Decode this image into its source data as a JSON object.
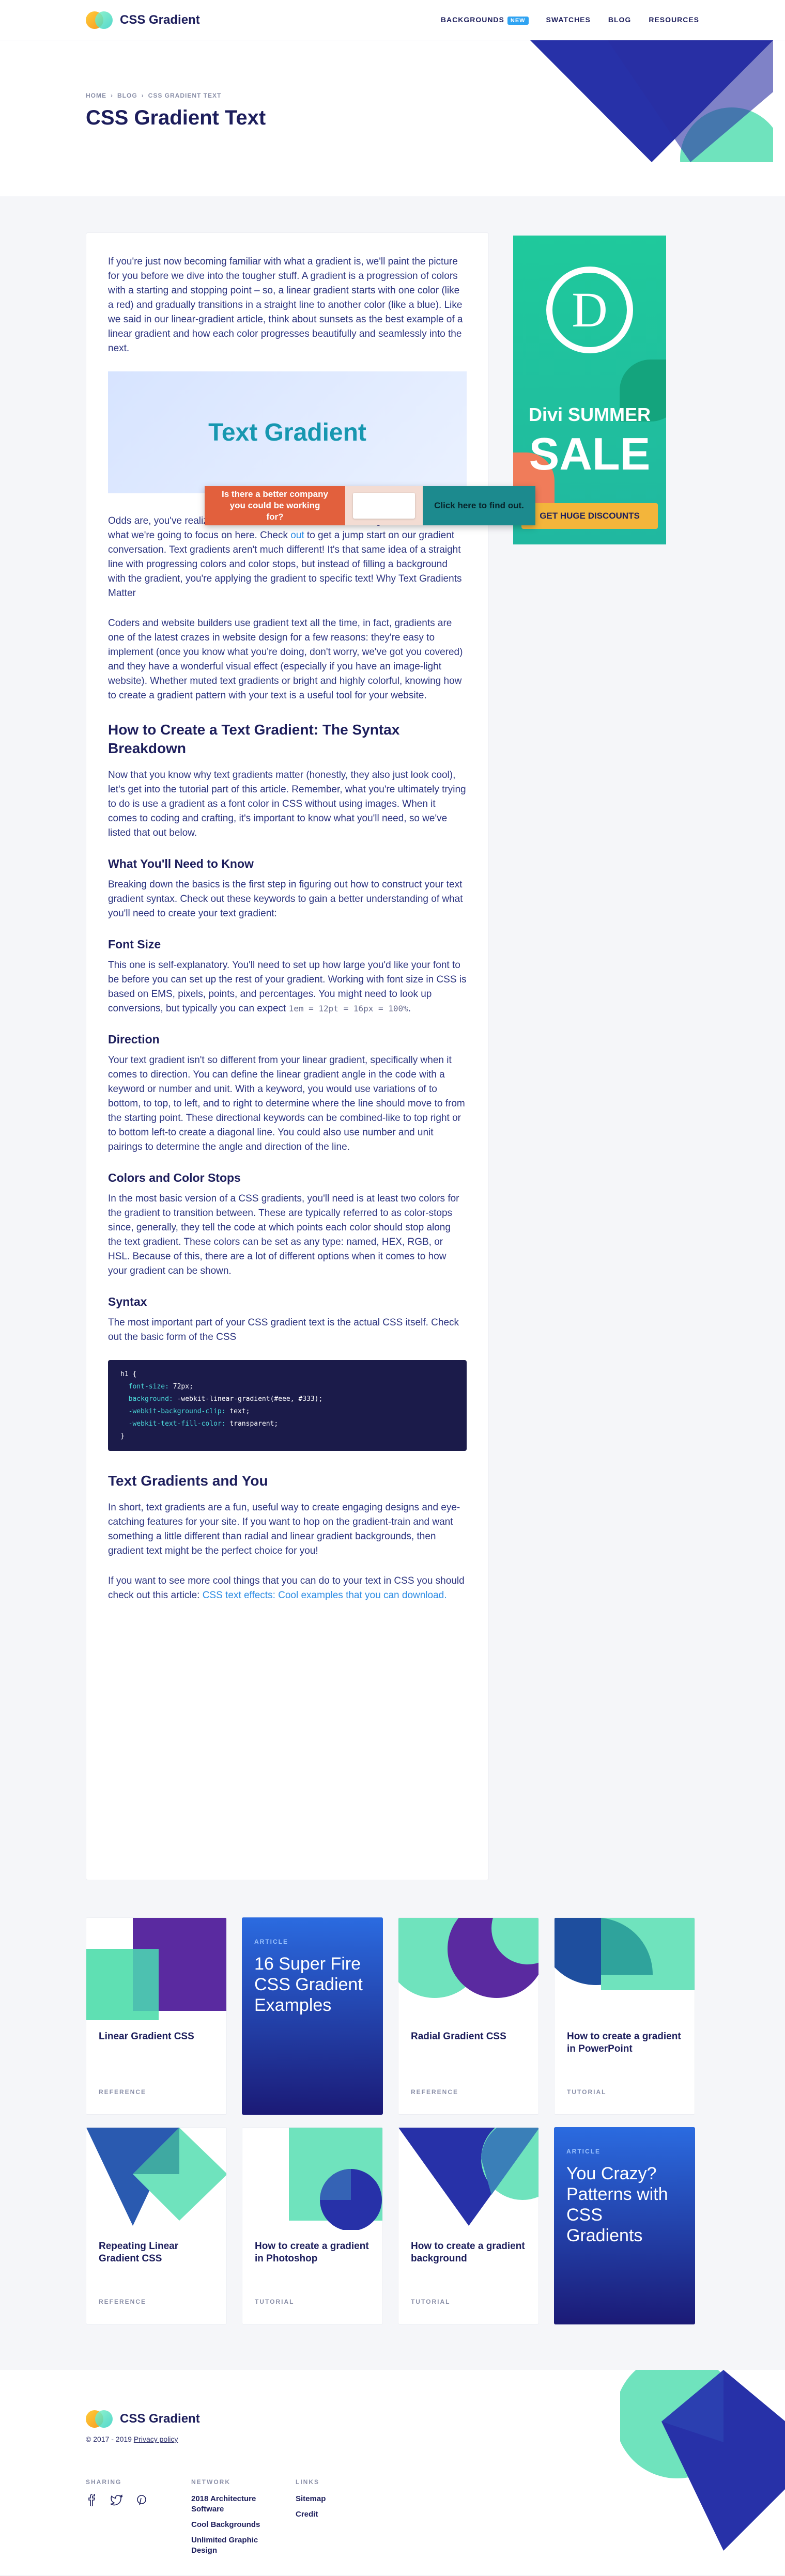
{
  "header": {
    "logo": "CSS Gradient",
    "nav": [
      {
        "label": "BACKGROUNDS",
        "badge": "NEW"
      },
      {
        "label": "SWATCHES"
      },
      {
        "label": "BLOG"
      },
      {
        "label": "RESOURCES"
      }
    ]
  },
  "hero": {
    "breadcrumb": [
      "HOME",
      "BLOG",
      "CSS GRADIENT TEXT"
    ],
    "title": "CSS Gradient Text"
  },
  "article": {
    "intro": "If you're just now becoming familiar with what a gradient is, we'll paint the picture for you before we dive into the tougher stuff. A gradient is a progression of colors with a starting and stopping point – so, a linear gradient starts with one color (like a red) and gradually transitions in a straight line to another color (like a blue). Like we said in our linear-gradient article, think about sunsets as the best example of a linear gradient and how each color progresses beautifully and seamlessly into the next.",
    "demo_text": "Text Gradient",
    "p2_a": "Odds are, you've realized how beautiful and versatile a linear gradient – which is what we're going to focus on here. Check ",
    "p2_link": "out",
    "p2_b": " to get a jump start on our gradient conversation. Text gradients aren't much different! It's that same idea of a straight line with progressing colors and color stops, but instead of filling a background with the gradient, you're applying the gradient to specific text! Why Text Gradients Matter",
    "p3": "Coders and website builders use gradient text all the time, in fact, gradients are one of the latest crazes in website design for a few reasons: they're easy to implement (once you know what you're doing, don't worry, we've got you covered) and they have a wonderful visual effect (especially if you have an image-light website). Whether muted text gradients or bright and highly colorful, knowing how to create a gradient pattern with your text is a useful tool for your website.",
    "h_syntax": "How to Create a Text Gradient: The Syntax Breakdown",
    "p4": "Now that you know why text gradients matter (honestly, they also just look cool), let's get into the tutorial part of this article. Remember, what you're ultimately trying to do is use a gradient as a font color in CSS without using images. When it comes to coding and crafting, it's important to know what you'll need, so we've listed that out below.",
    "h_need": "What You'll Need to Know",
    "p5": "Breaking down the basics is the first step in figuring out how to construct your text gradient syntax. Check out these keywords to gain a better understanding of what you'll need to create your text gradient:",
    "h_font": "Font Size",
    "p6": "This one is self-explanatory. You'll need to set up how large you'd like your font to be before you can set up the rest of your gradient. Working with font size in CSS is based on EMS, pixels, points, and percentages. You might need to look up conversions, but typically you can expect ",
    "p6_code": "1em = 12pt = 16px = 100%",
    "p6_end": ".",
    "h_dir": "Direction",
    "p7": "Your text gradient isn't so different from your linear gradient, specifically when it comes to direction. You can define the linear gradient angle in the code with a keyword or number and unit. With a keyword, you would use variations of to bottom, to top, to left, and to right to determine where the line should move to from the starting point. These directional keywords can be combined-like to top right or to bottom left-to create a diagonal line. You could also use number and unit pairings to determine the angle and direction of the line.",
    "h_colors": "Colors and Color Stops",
    "p8": "In the most basic version of a CSS gradients, you'll need is at least two colors for the gradient to transition between. These are typically referred to as color-stops since, generally, they tell the code at which points each color should stop along the text gradient. These colors can be set as any type: named, HEX, RGB, or HSL. Because of this, there are a lot of different options when it comes to how your gradient can be shown.",
    "h_syn": "Syntax",
    "p9": "The most important part of your CSS gradient text is the actual CSS itself. Check out the basic form of the CSS",
    "code": {
      "l1": "h1 {",
      "l2k": "font-size:",
      "l2v": " 72px;",
      "l3k": "background:",
      "l3v": " -webkit-linear-gradient(#eee, #333);",
      "l4k": "-webkit-background-clip:",
      "l4v": " text;",
      "l5k": "-webkit-text-fill-color:",
      "l5v": " transparent;",
      "l6": "}"
    },
    "h_you": "Text Gradients and You",
    "p10": "In short, text gradients are a fun, useful way to create engaging designs and eye-catching features for your site. If you want to hop on the gradient-train and want something a little different than radial and linear gradient backgrounds, then gradient text might be the perfect choice for you!",
    "p11": "If you want to see more cool things that you can do to your text in CSS you should check out this article: ",
    "p11_link": "CSS text effects: Cool examples that you can download."
  },
  "popup": {
    "left": "Is there a better company you could be working for?",
    "right": "Click here to find out."
  },
  "ad": {
    "letter": "D",
    "line1": "Divi SUMMER",
    "line2": "SALE",
    "cta": "GET HUGE DISCOUNTS"
  },
  "cards": [
    {
      "title": "Linear Gradient CSS",
      "tag": "REFERENCE"
    },
    {
      "feature_label": "ARTICLE",
      "feature_title": "16 Super Fire CSS Gradient Examples"
    },
    {
      "title": "Radial Gradient CSS",
      "tag": "REFERENCE"
    },
    {
      "title": "How to create a gradient in PowerPoint",
      "tag": "TUTORIAL"
    },
    {
      "title": "Repeating Linear Gradient CSS",
      "tag": "REFERENCE"
    },
    {
      "title": "How to create a gradient in Photoshop",
      "tag": "TUTORIAL"
    },
    {
      "title": "How to create a gradient background",
      "tag": "TUTORIAL"
    },
    {
      "feature_label": "ARTICLE",
      "feature_title": "You Crazy? Patterns with CSS Gradients"
    }
  ],
  "footer": {
    "logo": "CSS Gradient",
    "copyright": "© 2017 - 2019 ",
    "privacy": "Privacy policy",
    "sharing_head": "SHARING",
    "network_head": "NETWORK",
    "links_head": "LINKS",
    "network": [
      "2018 Architecture Software",
      "Cool Backgrounds",
      "Unlimited Graphic Design"
    ],
    "links": [
      "Sitemap",
      "Credit"
    ]
  },
  "colors": {
    "navy": "#1d1e5c",
    "link": "#2f8de4",
    "badge": "#2fa3f2",
    "mint": "#6fe3bd",
    "purple": "#4b2a9a",
    "blue": "#2731a8"
  },
  "icons": [
    "facebook-icon",
    "twitter-icon",
    "pinterest-icon"
  ]
}
